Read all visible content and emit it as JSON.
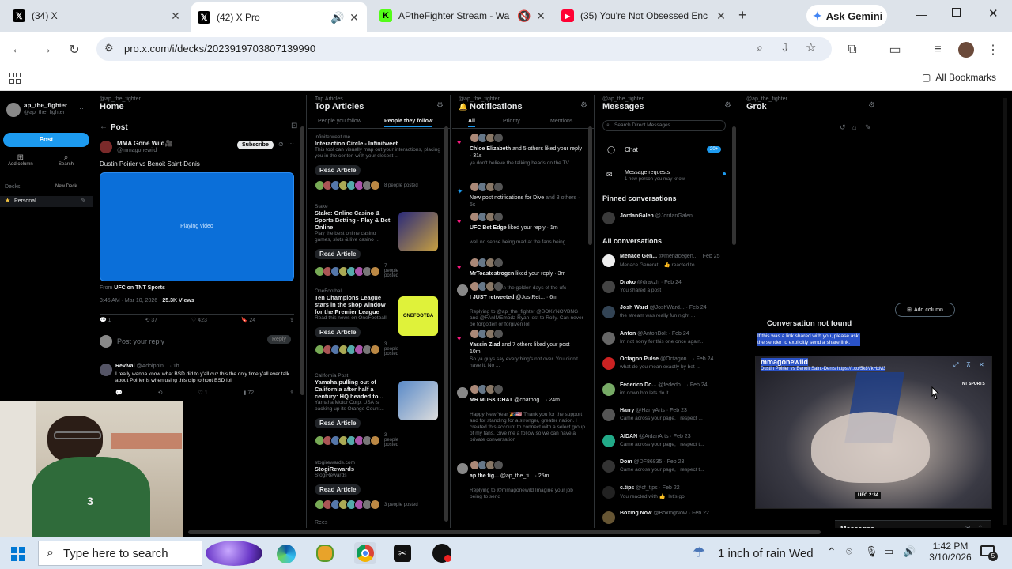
{
  "browser": {
    "tabs": [
      {
        "title": "(34) X",
        "favicon": "x-logo-icon"
      },
      {
        "title": "(42) X Pro",
        "favicon": "x-logo-icon",
        "active": true
      },
      {
        "title": "APtheFighter Stream - Wa",
        "favicon": "kick-logo-icon"
      },
      {
        "title": "(35) You're Not Obsessed Enc",
        "favicon": "youtube-logo-icon"
      }
    ],
    "new_tab": "+",
    "gemini_label": "Ask Gemini",
    "url": "pro.x.com/i/decks/2023919703807139990",
    "all_bookmarks": "All Bookmarks"
  },
  "sidebar": {
    "handle": "ap_the_fighter",
    "sub": "@ap_the_fighter",
    "post_button": "Post",
    "add_column": "Add column",
    "search": "Search",
    "decks_label": "Decks",
    "new_deck": "New Deck",
    "deck_name": "Personal"
  },
  "col_home": {
    "sup": "@ap_the_fighter",
    "title": "Home",
    "post_header": "Post",
    "author": "MMA Gone Wild🎥",
    "author_handle": "@mmagonewild",
    "subscribe": "Subscribe",
    "text": "Dustin Poirier vs Benoit Saint-Denis",
    "video_label": "Playing video",
    "source_prefix": "From",
    "source": "UFC on TNT Sports",
    "time": "3:45 AM · Mar 10, 2026 ·",
    "views": "25.3K Views",
    "stats": [
      "1",
      "37",
      "423",
      "24"
    ],
    "reply_placeholder": "Post your reply",
    "reply_button": "Reply",
    "reply_author": "Revival",
    "reply_handle": "@Adolphin... · 1h",
    "reply_text": "I really wanna know what BSD did to y'all cuz this the only time y'all ever talk about Poirier is when using this clip to hoot BSD lol",
    "reply_stats": [
      "",
      "",
      "1",
      "72"
    ]
  },
  "col_articles": {
    "sup": "Top Articles",
    "title": "Top Articles",
    "tab1": "People you follow",
    "tab2": "People they follow",
    "read_label": "Read Article",
    "items": [
      {
        "site": "infinitetweet.me",
        "title": "Interaction Circle - Infinitweet",
        "desc": "This tool can visually map out your interactions, placing you in the center, with your closest ...",
        "people": "8 people posted"
      },
      {
        "site": "Stake",
        "title": "Stake: Online Casino & Sports Betting - Play & Bet Online",
        "desc": "Play the best online casino games, slots & live casino ...",
        "people": "7 people posted"
      },
      {
        "site": "OneFootball",
        "title": "Ten Champions League stars in the shop window for the Premier League",
        "desc": "Read this news on OneFootball.",
        "people": "3 people posted",
        "thumb_text": "ONEFOOTBA"
      },
      {
        "site": "California Post",
        "title": "Yamaha pulling out of California after half a century: HQ headed to...",
        "desc": "Yamaha Motor Corp. USA is packing up its Orange Count...",
        "people": "3 people posted"
      },
      {
        "site": "stogirewards.com",
        "title": "StogiRewards",
        "desc": "StogiRewards",
        "people": "3 people posted"
      }
    ],
    "last": "Rees"
  },
  "col_notif": {
    "sup": "@ap_the_fighter",
    "title": "Notifications",
    "tabs": [
      "All",
      "Priority",
      "Mentions"
    ],
    "items": [
      {
        "name": "Chloe Elizabeth",
        "text": "and 5 others liked your reply · 31s",
        "sub": "ya don't believe the talking heads on the TV"
      },
      {
        "name": "",
        "text": "New post notifications for Dive",
        "tail": "and 3 others · 5s",
        "sub": ""
      },
      {
        "name": "UFC Bet Edge",
        "text": "liked your reply · 1m",
        "sub": "well no sense being mad at the fans being ..."
      },
      {
        "name": "MrToastestrogen",
        "text": "liked your reply · 3m",
        "sub": "this was back in the golden days of the ufc"
      },
      {
        "name": "I JUST retweeted",
        "text": "@JustRet... · 6m",
        "sub": "Replying to @ap_the_fighter @BOXYNOVBNG and @FAnIMEmodz Ryan lost to Rolly. Can never be forgotten or forgiven lol"
      },
      {
        "name": "Yassin Ziad",
        "text": "and 7 others liked your post · 10m",
        "sub": "So ya guys say everything's not over. You didn't have it. No ..."
      },
      {
        "name": "MR MUSK CHAT",
        "text": "@chatbog... · 24m",
        "sub": "Happy New Year 🎉🇺🇸 Thank you for the support and for standing for a stronger, greater nation. I created this account to connect with a select group of my fans. Give me a follow so we can have a private conversation"
      },
      {
        "name": "ap the fig...",
        "text": "@ap_the_fi... · 25m",
        "sub": "Replying to @mmagonewild Imagine your job being to send"
      }
    ]
  },
  "col_messages": {
    "sup": "@ap_the_fighter",
    "title": "Messages",
    "search_placeholder": "Search Direct Messages",
    "chat": "Chat",
    "chat_badge": "20+",
    "requests": "Message requests",
    "requests_sub": "1 new person you may know",
    "pinned": "Pinned conversations",
    "pinned_name": "JordanGalen",
    "pinned_handle": "@JordanGalen",
    "all": "All conversations",
    "convs": [
      {
        "name": "Menace Gen...",
        "handle": "@menacegen... · Feb 25",
        "msg": "Menace Generat... 👍 reacted to ..."
      },
      {
        "name": "Drako",
        "handle": "@drakzh · Feb 24",
        "msg": "You shared a post"
      },
      {
        "name": "Josh Ward",
        "handle": "@JoshWard... · Feb 24",
        "msg": "the stream was really fun night ..."
      },
      {
        "name": "Anton",
        "handle": "@AntonBolt · Feb 24",
        "msg": "Im not sorry for this one once again..."
      },
      {
        "name": "Octagon Pulse",
        "handle": "@Octagon... · Feb 24",
        "msg": "what do you mean exactly by bet ..."
      },
      {
        "name": "Federico Do...",
        "handle": "@fededo... · Feb 24",
        "msg": "im down bro lets do it"
      },
      {
        "name": "Harry",
        "handle": "@HarryArts · Feb 23",
        "msg": "Came across your page, I respect ..."
      },
      {
        "name": "AIDAN",
        "handle": "@AidanArts · Feb 23",
        "msg": "Came across your page, I respect t..."
      },
      {
        "name": "Dom",
        "handle": "@DF86835 · Feb 23",
        "msg": "Came across your page, I respect t..."
      },
      {
        "name": "c.tips",
        "handle": "@cf_tips · Feb 22",
        "msg": "You reacted with 👍: let's go"
      },
      {
        "name": "Boxing Now",
        "handle": "@BoxingNow · Feb 22",
        "msg": ""
      }
    ]
  },
  "col_grok": {
    "sup": "@ap_the_fighter",
    "title": "Grok"
  },
  "add_column": "Add column",
  "conversation_not_found": "Conversation not found",
  "conv_hint": "If this was a link shared with you, please ask the sender to explicitly send a share link.",
  "pip": {
    "title": "mmagonewild",
    "subtitle": "Dustin Poirier vs Benoit Saint-Denis https://t.co/5k8VkHxM3",
    "brand": "TNT SPORTS",
    "score": "UFC 2:34"
  },
  "messages_dock": "Messages",
  "taskbar": {
    "search_placeholder": "Type here to search",
    "weather": "1 inch of rain Wed",
    "time": "1:42 PM",
    "date": "3/10/2026",
    "notification_count": "5"
  },
  "colors": {
    "x_blue": "#1d9bf0",
    "like_pink": "#f91880",
    "chrome_tabbar": "#dde3ea"
  }
}
